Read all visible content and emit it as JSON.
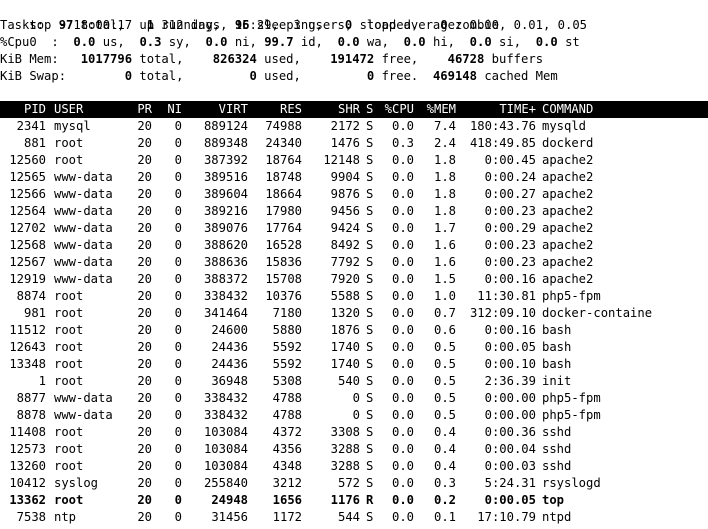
{
  "summary": {
    "line1": {
      "label": "top - 18:00:17 up 312 days, 15:29,  3 users,  load average: 0.00, 0.01, 0.05"
    },
    "tasks": [
      {
        "t": "Tasks: ",
        "b": false
      },
      {
        "t": " 97",
        "b": true
      },
      {
        "t": " total,   ",
        "b": false
      },
      {
        "t": "1",
        "b": true
      },
      {
        "t": " running,  ",
        "b": false
      },
      {
        "t": "96",
        "b": true
      },
      {
        "t": " sleeping,   ",
        "b": false
      },
      {
        "t": "0",
        "b": true
      },
      {
        "t": " stopped,   ",
        "b": false
      },
      {
        "t": "0",
        "b": true
      },
      {
        "t": " zombie",
        "b": false
      }
    ],
    "cpu": [
      {
        "t": "%Cpu0  : ",
        "b": false
      },
      {
        "t": " 0.0",
        "b": true
      },
      {
        "t": " us,  ",
        "b": false
      },
      {
        "t": "0.3",
        "b": true
      },
      {
        "t": " sy,  ",
        "b": false
      },
      {
        "t": "0.0",
        "b": true
      },
      {
        "t": " ni, ",
        "b": false
      },
      {
        "t": "99.7",
        "b": true
      },
      {
        "t": " id,  ",
        "b": false
      },
      {
        "t": "0.0",
        "b": true
      },
      {
        "t": " wa,  ",
        "b": false
      },
      {
        "t": "0.0",
        "b": true
      },
      {
        "t": " hi,  ",
        "b": false
      },
      {
        "t": "0.0",
        "b": true
      },
      {
        "t": " si,  ",
        "b": false
      },
      {
        "t": "0.0",
        "b": true
      },
      {
        "t": " st",
        "b": false
      }
    ],
    "mem": [
      {
        "t": "KiB Mem:  ",
        "b": false
      },
      {
        "t": " 1017796",
        "b": true
      },
      {
        "t": " total,   ",
        "b": false
      },
      {
        "t": " 826324",
        "b": true
      },
      {
        "t": " used,   ",
        "b": false
      },
      {
        "t": " 191472",
        "b": true
      },
      {
        "t": " free,   ",
        "b": false
      },
      {
        "t": " 46728",
        "b": true
      },
      {
        "t": " buffers",
        "b": false
      }
    ],
    "swap": [
      {
        "t": "KiB Swap: ",
        "b": false
      },
      {
        "t": "       0",
        "b": true
      },
      {
        "t": " total,   ",
        "b": false
      },
      {
        "t": "      0",
        "b": true
      },
      {
        "t": " used,   ",
        "b": false
      },
      {
        "t": "      0",
        "b": true
      },
      {
        "t": " free.  ",
        "b": false
      },
      {
        "t": "469148",
        "b": true
      },
      {
        "t": " cached Mem",
        "b": false
      }
    ]
  },
  "columns": [
    "PID",
    "USER",
    "PR",
    "NI",
    "VIRT",
    "RES",
    "SHR",
    "S",
    "%CPU",
    "%MEM",
    "TIME+",
    "COMMAND"
  ],
  "processes": [
    [
      "2341",
      "mysql",
      "20",
      "0",
      "889124",
      "74988",
      "2172",
      "S",
      "0.0",
      "7.4",
      "180:43.76",
      "mysqld",
      false
    ],
    [
      "881",
      "root",
      "20",
      "0",
      "889348",
      "24340",
      "1476",
      "S",
      "0.3",
      "2.4",
      "418:49.85",
      "dockerd",
      false
    ],
    [
      "12560",
      "root",
      "20",
      "0",
      "387392",
      "18764",
      "12148",
      "S",
      "0.0",
      "1.8",
      "0:00.45",
      "apache2",
      false
    ],
    [
      "12565",
      "www-data",
      "20",
      "0",
      "389516",
      "18748",
      "9904",
      "S",
      "0.0",
      "1.8",
      "0:00.24",
      "apache2",
      false
    ],
    [
      "12566",
      "www-data",
      "20",
      "0",
      "389604",
      "18664",
      "9876",
      "S",
      "0.0",
      "1.8",
      "0:00.27",
      "apache2",
      false
    ],
    [
      "12564",
      "www-data",
      "20",
      "0",
      "389216",
      "17980",
      "9456",
      "S",
      "0.0",
      "1.8",
      "0:00.23",
      "apache2",
      false
    ],
    [
      "12702",
      "www-data",
      "20",
      "0",
      "389076",
      "17764",
      "9424",
      "S",
      "0.0",
      "1.7",
      "0:00.29",
      "apache2",
      false
    ],
    [
      "12568",
      "www-data",
      "20",
      "0",
      "388620",
      "16528",
      "8492",
      "S",
      "0.0",
      "1.6",
      "0:00.23",
      "apache2",
      false
    ],
    [
      "12567",
      "www-data",
      "20",
      "0",
      "388636",
      "15836",
      "7792",
      "S",
      "0.0",
      "1.6",
      "0:00.23",
      "apache2",
      false
    ],
    [
      "12919",
      "www-data",
      "20",
      "0",
      "388372",
      "15708",
      "7920",
      "S",
      "0.0",
      "1.5",
      "0:00.16",
      "apache2",
      false
    ],
    [
      "8874",
      "root",
      "20",
      "0",
      "338432",
      "10376",
      "5588",
      "S",
      "0.0",
      "1.0",
      "11:30.81",
      "php5-fpm",
      false
    ],
    [
      "981",
      "root",
      "20",
      "0",
      "341464",
      "7180",
      "1320",
      "S",
      "0.0",
      "0.7",
      "312:09.10",
      "docker-containe",
      false
    ],
    [
      "11512",
      "root",
      "20",
      "0",
      "24600",
      "5880",
      "1876",
      "S",
      "0.0",
      "0.6",
      "0:00.16",
      "bash",
      false
    ],
    [
      "12643",
      "root",
      "20",
      "0",
      "24436",
      "5592",
      "1740",
      "S",
      "0.0",
      "0.5",
      "0:00.05",
      "bash",
      false
    ],
    [
      "13348",
      "root",
      "20",
      "0",
      "24436",
      "5592",
      "1740",
      "S",
      "0.0",
      "0.5",
      "0:00.10",
      "bash",
      false
    ],
    [
      "1",
      "root",
      "20",
      "0",
      "36948",
      "5308",
      "540",
      "S",
      "0.0",
      "0.5",
      "2:36.39",
      "init",
      false
    ],
    [
      "8877",
      "www-data",
      "20",
      "0",
      "338432",
      "4788",
      "0",
      "S",
      "0.0",
      "0.5",
      "0:00.00",
      "php5-fpm",
      false
    ],
    [
      "8878",
      "www-data",
      "20",
      "0",
      "338432",
      "4788",
      "0",
      "S",
      "0.0",
      "0.5",
      "0:00.00",
      "php5-fpm",
      false
    ],
    [
      "11408",
      "root",
      "20",
      "0",
      "103084",
      "4372",
      "3308",
      "S",
      "0.0",
      "0.4",
      "0:00.36",
      "sshd",
      false
    ],
    [
      "12573",
      "root",
      "20",
      "0",
      "103084",
      "4356",
      "3288",
      "S",
      "0.0",
      "0.4",
      "0:00.04",
      "sshd",
      false
    ],
    [
      "13260",
      "root",
      "20",
      "0",
      "103084",
      "4348",
      "3288",
      "S",
      "0.0",
      "0.4",
      "0:00.03",
      "sshd",
      false
    ],
    [
      "10412",
      "syslog",
      "20",
      "0",
      "255840",
      "3212",
      "572",
      "S",
      "0.0",
      "0.3",
      "5:24.31",
      "rsyslogd",
      false
    ],
    [
      "13362",
      "root",
      "20",
      "0",
      "24948",
      "1656",
      "1176",
      "R",
      "0.0",
      "0.2",
      "0:00.05",
      "top",
      true
    ],
    [
      "7538",
      "ntp",
      "20",
      "0",
      "31456",
      "1172",
      "544",
      "S",
      "0.0",
      "0.1",
      "17:10.79",
      "ntpd",
      false
    ]
  ]
}
